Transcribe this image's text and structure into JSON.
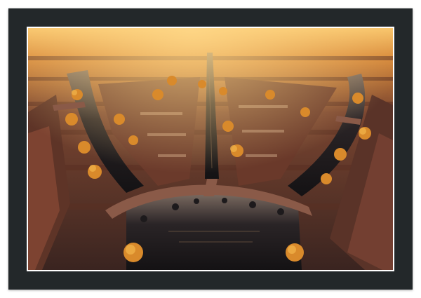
{
  "product": {
    "type": "framed print",
    "frame_color": "#23282a",
    "mat_color": "#ffffff"
  },
  "artwork": {
    "subject_icon": "aerial-canal-city-photo",
    "palette": {
      "sky_glow": "#f6b24a",
      "water": "#1d1a1c",
      "rooftops": "#6b3b2a",
      "autumn_trees": "#d98a2b",
      "street": "#8a5a48"
    }
  }
}
